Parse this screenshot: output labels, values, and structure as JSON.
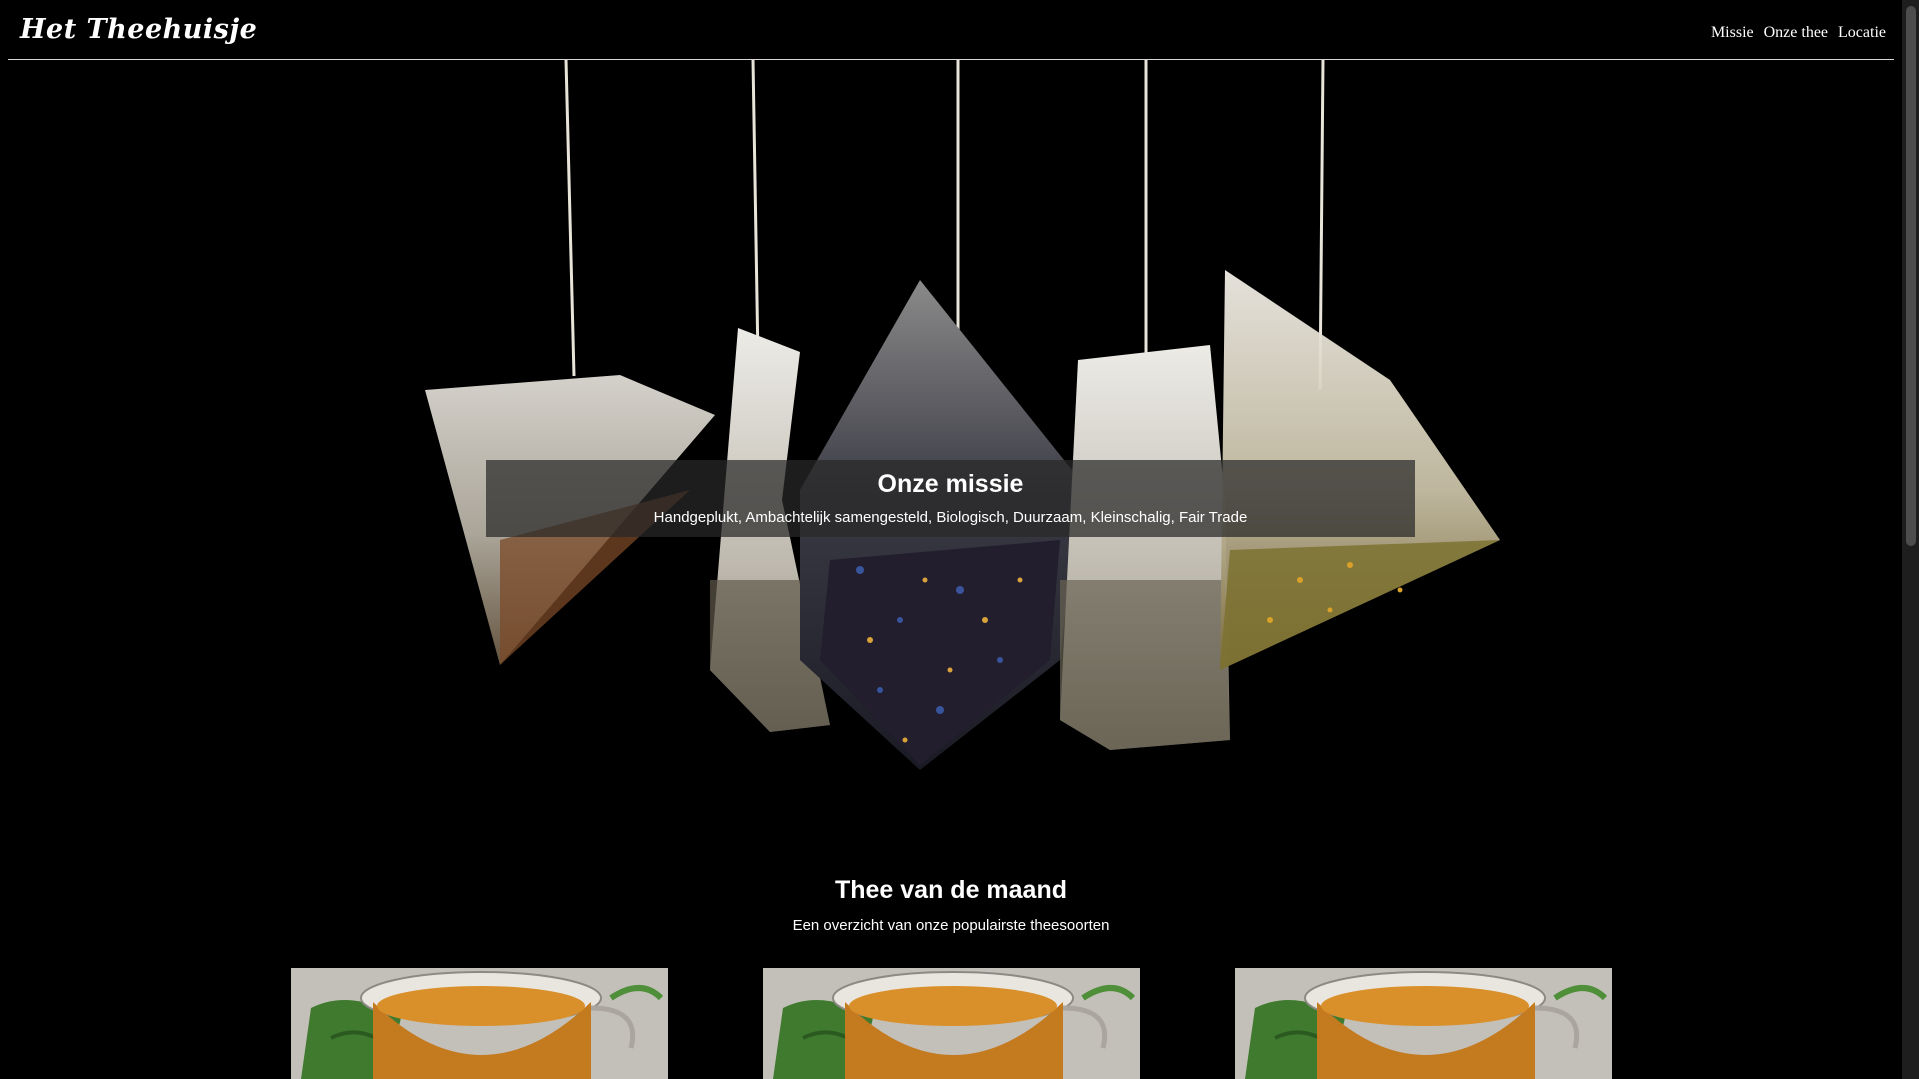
{
  "header": {
    "logo": "Het Theehuisje",
    "nav": [
      "Missie",
      "Onze thee",
      "Locatie"
    ]
  },
  "hero": {
    "title": "Onze missie",
    "subtitle": "Handgeplukt, Ambachtelijk samengesteld, Biologisch, Duurzaam, Kleinschalig, Fair Trade"
  },
  "tea_of_month": {
    "title": "Thee van de maand",
    "subtitle": "Een overzicht van onze populairste theesoorten",
    "cards": [
      {
        "image": "tea-cup-image"
      },
      {
        "image": "tea-cup-image"
      },
      {
        "image": "tea-cup-image"
      }
    ]
  }
}
